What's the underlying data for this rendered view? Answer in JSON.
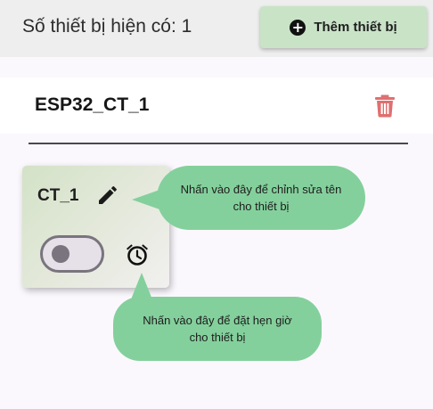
{
  "header": {
    "device_count_text": "Số thiết bị hiện có: 1",
    "add_button_label": "Thêm thiết bị"
  },
  "device": {
    "name": "ESP32_CT_1"
  },
  "control": {
    "name": "CT_1",
    "switch_on": false
  },
  "tooltips": {
    "edit_hint": "Nhấn vào đây để chỉnh sửa tên cho thiết bị",
    "alarm_hint": "Nhấn vào đây để đặt hẹn giờ cho thiết bị"
  },
  "icons": {
    "add": "add-circle-icon",
    "delete": "trash-icon",
    "edit": "pencil-icon",
    "alarm": "alarm-clock-icon"
  },
  "colors": {
    "add_button_bg": "#c9e3c7",
    "delete_icon": "#e06f6f",
    "tooltip_bg": "#84d09c",
    "toggle_outline": "#79747e"
  }
}
